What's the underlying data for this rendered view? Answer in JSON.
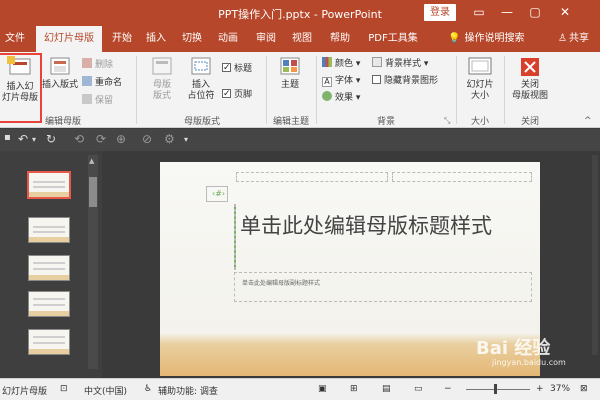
{
  "window": {
    "title": "PPT操作入门.pptx - PowerPoint",
    "login_label": "登录"
  },
  "tabs": [
    {
      "label": "文件"
    },
    {
      "label": "幻灯片母版"
    },
    {
      "label": "开始"
    },
    {
      "label": "插入"
    },
    {
      "label": "切换"
    },
    {
      "label": "动画"
    },
    {
      "label": "审阅"
    },
    {
      "label": "视图"
    },
    {
      "label": "帮助"
    },
    {
      "label": "PDF工具集"
    }
  ],
  "tell_me": "操作说明搜索",
  "share": "共享",
  "ribbon": {
    "groups": [
      {
        "label": "编辑母版"
      },
      {
        "label": "母版版式"
      },
      {
        "label": "编辑主题"
      },
      {
        "label": "背景"
      },
      {
        "label": "大小"
      },
      {
        "label": "关闭"
      }
    ],
    "insert_master": "插入幻\n灯片母版",
    "insert_layout": "插入版式",
    "delete": "删除",
    "rename": "重命名",
    "preserve": "保留",
    "master_layout": "母版\n版式",
    "insert_placeholder": "插入\n占位符",
    "title_check": "标题",
    "footer_check": "页脚",
    "themes": "主题",
    "colors": "颜色",
    "fonts": "字体",
    "effects": "效果",
    "bg_styles": "背景样式",
    "hide_bg": "隐藏背景图形",
    "slide_size": "幻灯片\n大小",
    "close_master": "关闭\n母版视图"
  },
  "slide": {
    "title": "单击此处编辑母版标题样式",
    "subtitle": "单击此处编辑母版副标题样式"
  },
  "status": {
    "view": "幻灯片母版",
    "language": "中文(中国)",
    "accessibility": "辅助功能: 调查",
    "zoom": "37%"
  },
  "watermark": {
    "brand": "Bai 经验",
    "url": "jingyan.baidu.com"
  },
  "colors": {
    "accent": "#b7472a",
    "highlight": "#e8423a"
  }
}
